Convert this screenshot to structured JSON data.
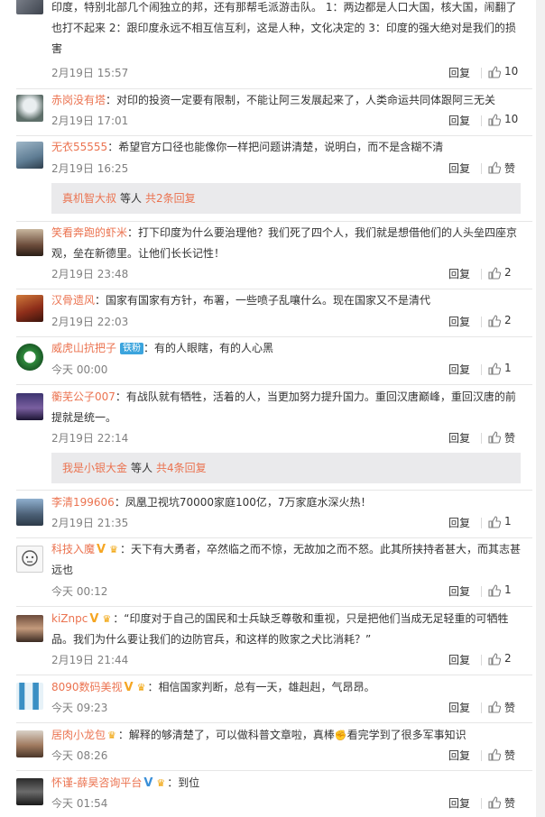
{
  "labels": {
    "reply": "回复",
    "others": "等人",
    "like_zero": "赞"
  },
  "comments": [
    {
      "user": "",
      "text": "印度，特别北部几个闹独立的邦，还有那帮毛派游击队。 1：两边都是人口大国，核大国，闹翻了也打不起来 2：跟印度永远不相互信互利，这是人种，文化决定的 3：印度的强大绝对是我们的损害",
      "time": "2月19日 15:57",
      "likes": "10"
    },
    {
      "user": "赤岗没有塔",
      "text": "：对印的投资一定要有限制，不能让阿三发展起来了，人类命运共同体跟阿三无关",
      "time": "2月19日 17:01",
      "likes": "10"
    },
    {
      "user": "无衣55555",
      "text": "：希望官方口径也能像你一样把问题讲清楚，说明白，而不是含糊不清",
      "time": "2月19日 16:25",
      "likes": "赞"
    },
    {
      "user": "笑看奔跑的虾米",
      "text": "：打下印度为什么要治理他？我们死了四个人，我们就是想借他们的人头垒四座京观，垒在新德里。让他们长长记性！",
      "time": "2月19日 23:48",
      "likes": "2"
    },
    {
      "user": "汉骨遗风",
      "text": "：国家有国家有方针，布署，一些喷子乱嚷什么。现在国家又不是清代",
      "time": "2月19日 22:03",
      "likes": "2"
    },
    {
      "user": "威虎山抗把子",
      "badge": "铁粉",
      "text": "：有的人眼瞎，有的人心黑",
      "time": "今天 00:00",
      "likes": "1"
    },
    {
      "user": "蘅芜公子007",
      "text": "：有战队就有牺牲，活着的人，当更加努力提升国力。重回汉唐巅峰，重回汉唐的前提就是统一。",
      "time": "2月19日 22:14",
      "likes": "赞"
    },
    {
      "user": "李清199606",
      "text": "：凤凰卫视坑70000家庭100亿，7万家庭水深火热！",
      "time": "2月19日 21:35",
      "likes": "1"
    },
    {
      "user": "科技入魔",
      "text": "：天下有大勇者，卒然临之而不惊，无故加之而不怒。此其所挟持者甚大，而其志甚远也",
      "time": "今天 00:12",
      "likes": "1"
    },
    {
      "user": "kiZnpc",
      "text": "：“印度对于自己的国民和士兵缺乏尊敬和重视，只是把他们当成无足轻重的可牺牲品。我们为什么要让我们的边防官兵，和这样的败家之犬比消耗？”",
      "time": "2月19日 21:44",
      "likes": "2"
    },
    {
      "user": "8090数码美视",
      "text": "：相信国家判断，总有一天，雄赳赳，气昂昂。",
      "time": "今天 09:23",
      "likes": "赞"
    },
    {
      "user": "居肉小龙包",
      "text": "：解释的够清楚了，可以做科普文章啦，真棒",
      "text2": "看完学到了很多军事知识",
      "time": "今天 08:26",
      "likes": "赞"
    },
    {
      "user": "怀谨-薛昊咨询平台",
      "text": "：到位",
      "time": "今天 01:54",
      "likes": "赞"
    }
  ],
  "subthreads": [
    {
      "user": "真机智大叔",
      "count": "共2条回复"
    },
    {
      "user": "我是小银大金",
      "count": "共4条回复"
    }
  ]
}
